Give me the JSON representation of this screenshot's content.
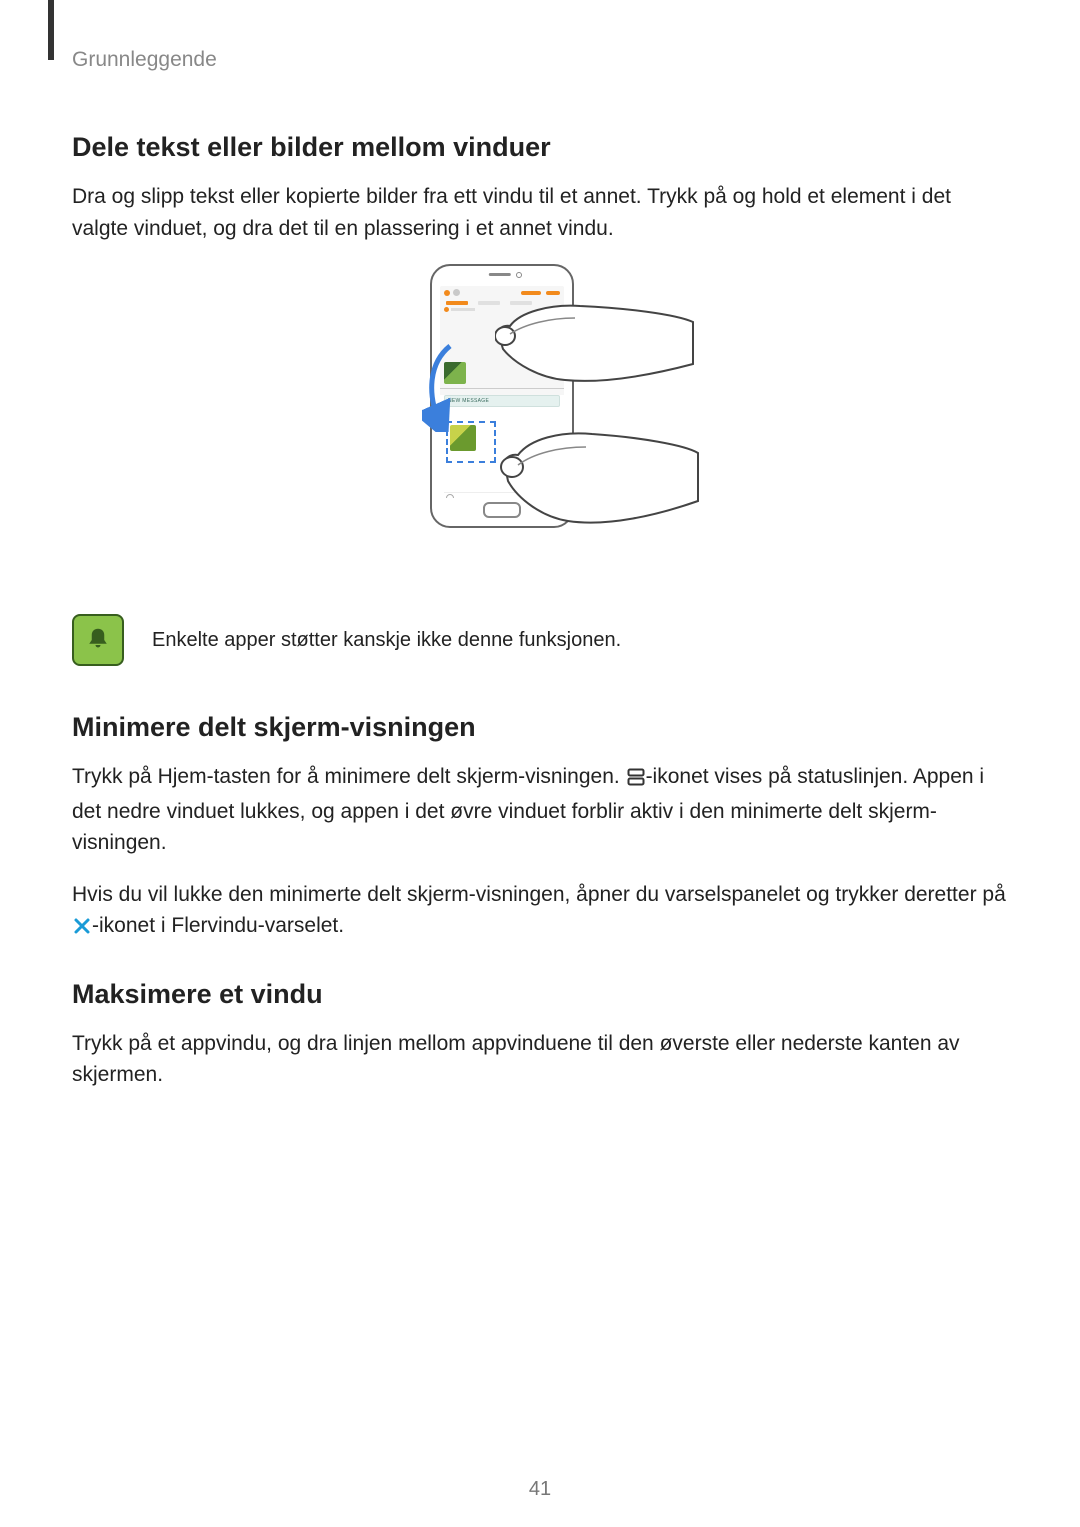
{
  "breadcrumb": "Grunnleggende",
  "section1": {
    "heading": "Dele tekst eller bilder mellom vinduer",
    "para": "Dra og slipp tekst eller kopierte bilder fra ett vindu til et annet. Trykk på og hold et element i det valgte vinduet, og dra det til en plassering i et annet vindu."
  },
  "illustration": {
    "new_message_label": "NEW MESSAGE"
  },
  "note": {
    "text": "Enkelte apper støtter kanskje ikke denne funksjonen."
  },
  "section2": {
    "heading": "Minimere delt skjerm-visningen",
    "para1_a": "Trykk på Hjem-tasten for å minimere delt skjerm-visningen. ",
    "para1_b": "-ikonet vises på statuslinjen. Appen i det nedre vinduet lukkes, og appen i det øvre vinduet forblir aktiv i den minimerte delt skjerm-visningen.",
    "para2_a": "Hvis du vil lukke den minimerte delt skjerm-visningen, åpner du varselspanelet og trykker deretter på ",
    "para2_b": "-ikonet i Flervindu-varselet."
  },
  "section3": {
    "heading": "Maksimere et vindu",
    "para": "Trykk på et appvindu, og dra linjen mellom appvinduene til den øverste eller nederste kanten av skjermen."
  },
  "page_number": "41"
}
